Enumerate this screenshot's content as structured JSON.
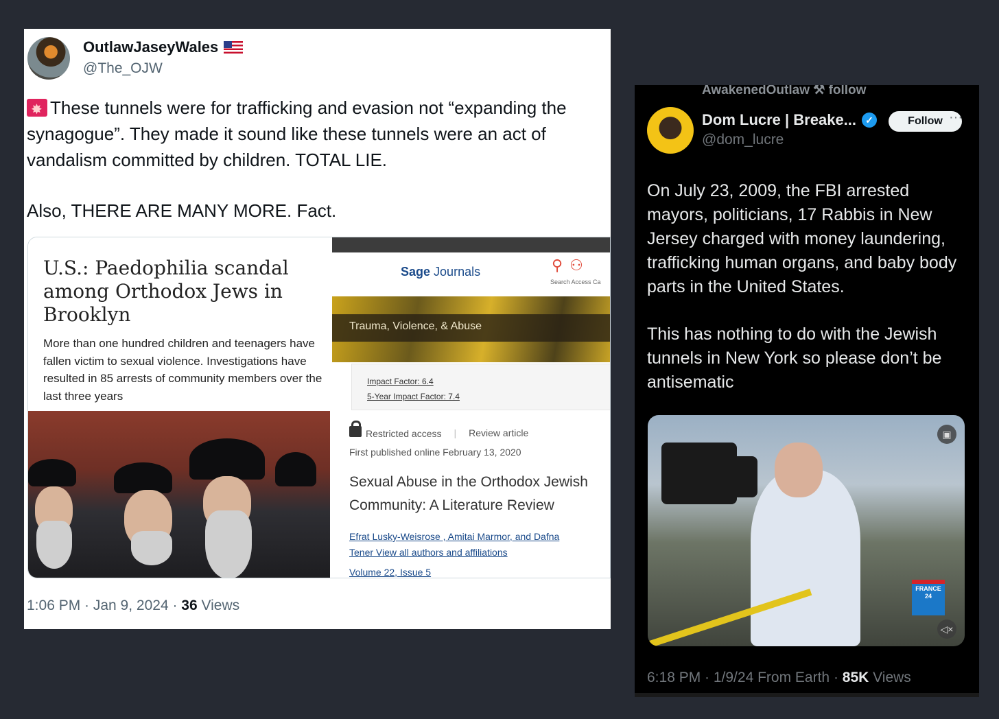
{
  "left_tweet": {
    "display_name": "OutlawJaseyWales",
    "handle": "@The_OJW",
    "paragraph_1": "These tunnels were for trafficking and evasion not “expanding the synagogue”. They made it sound like these tunnels were an act of vandalism committed by children. TOTAL LIE.",
    "paragraph_2": "Also, THERE ARE MANY MORE. Fact.",
    "media": {
      "article": {
        "headline": "U.S.: Paedophilia scandal among Orthodox Jews in Brooklyn",
        "summary": "More than one hundred children and teenagers have fallen victim to sexual violence. Investigations have resulted in 85 arrests of community members over the last three years"
      },
      "journal": {
        "publisher_bold": "Sage",
        "publisher_rest": "Journals",
        "icons_label": "Search  Access  Ca",
        "journal_name": "Trauma, Violence, & Abuse",
        "impact_factor": "Impact Factor: 6.4",
        "five_year_impact": "5-Year Impact Factor: 7.4",
        "access_label": "Restricted access",
        "article_type": "Review article",
        "published": "First published online February 13, 2020",
        "title": "Sexual Abuse in the Orthodox Jewish Community: A Literature Review",
        "authors_line_1": "Efrat Lusky-Weisrose , Amitai Marmor, and Dafna",
        "authors_line_2": "Tener   View all authors and affiliations",
        "volume": "Volume 22, Issue 5"
      }
    },
    "time": "1:06 PM · Jan 9, 2024 · ",
    "views_count": "36",
    "views_label": " Views"
  },
  "right_tweet": {
    "repost_label": "AwakenedOutlaw ⚒ follow",
    "display_name": "Dom Lucre | Breake...",
    "handle": "@dom_lucre",
    "follow_label": "Follow",
    "more_label": "···",
    "paragraph_1": "On July 23, 2009, the FBI arrested mayors, politicians, 17 Rabbis in New Jersey charged with money laundering, trafficking human organs, and baby body parts in the United States.",
    "paragraph_2": "This has nothing to do with the Jewish tunnels in New York so please don’t be antisematic",
    "video_badge": "FRANCE 24",
    "time": "6:18 PM · 1/9/24 From Earth · ",
    "views_count": "85K",
    "views_label": " Views"
  },
  "icons": {
    "left_avatar": "avatar-icon",
    "flag": "us-flag-icon",
    "siren": "rotating-light-icon",
    "verified": "verified-badge-icon",
    "lock": "lock-icon",
    "mute": "mute-icon"
  },
  "colors": {
    "page_bg": "#262a33",
    "left_card_bg": "#ffffff",
    "right_card_bg": "#000000",
    "verified_blue": "#1d9bf0",
    "sage_blue": "#1a4a8a"
  }
}
